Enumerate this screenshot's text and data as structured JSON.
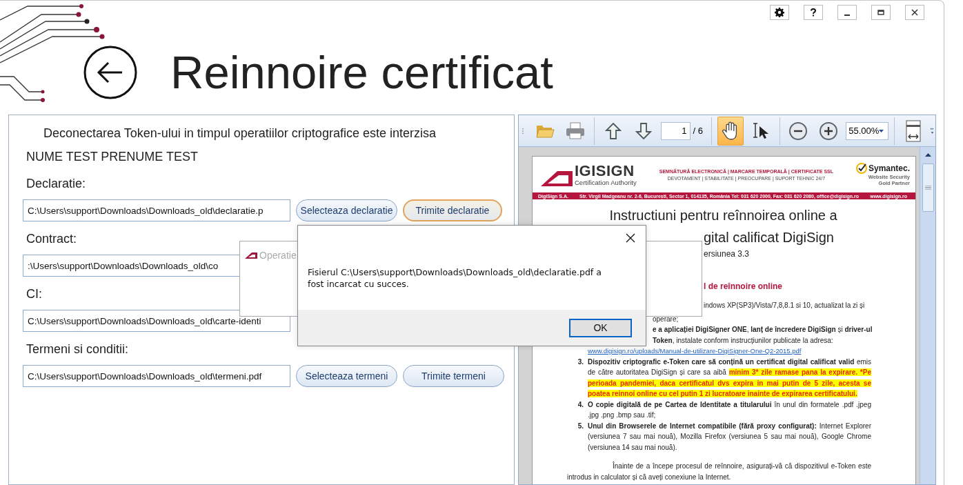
{
  "window": {
    "title": "Reinnoire certificat",
    "controls": [
      {
        "kind": "settings"
      },
      {
        "kind": "help"
      },
      {
        "kind": "minimize"
      },
      {
        "kind": "maximize"
      },
      {
        "kind": "close"
      }
    ]
  },
  "form": {
    "warning": "Deconectarea Token-ului in timpul operatiilor criptografice este interzisa",
    "holder": "NUME TEST PRENUME TEST",
    "rows": [
      {
        "label": "Declaratie:",
        "value": "C:\\Users\\support\\Downloads\\Downloads_old\\declaratie.p",
        "buttons": [
          {
            "label": "Selecteaza declaratie",
            "focused": false
          },
          {
            "label": "Trimite declaratie",
            "focused": true
          }
        ]
      },
      {
        "label": "Contract:",
        "value": ":\\Users\\support\\Downloads\\Downloads_old\\co"
      },
      {
        "label": "CI:",
        "value": "C:\\Users\\support\\Downloads\\Downloads_old\\carte-identi"
      },
      {
        "label": "Termeni si conditii:",
        "value": "C:\\Users\\support\\Downloads\\Downloads_old\\termeni.pdf",
        "buttons": [
          {
            "label": "Selecteaza termeni",
            "focused": false
          },
          {
            "label": "Trimite termeni",
            "focused": false
          }
        ]
      }
    ]
  },
  "viewer": {
    "toolbar": [
      {
        "kind": "open",
        "selected": false
      },
      {
        "kind": "print",
        "selected": false
      },
      {
        "kind": "sep"
      },
      {
        "kind": "prev",
        "selected": false
      },
      {
        "kind": "next",
        "selected": false
      },
      {
        "kind": "page",
        "value": "1",
        "total": "/ 6"
      },
      {
        "kind": "sep"
      },
      {
        "kind": "hand",
        "selected": true
      },
      {
        "kind": "select",
        "selected": false
      },
      {
        "kind": "sep"
      },
      {
        "kind": "zoom-out",
        "selected": false
      },
      {
        "kind": "zoom-in",
        "selected": false
      },
      {
        "kind": "zoom",
        "value": "55.00%"
      },
      {
        "kind": "sep"
      },
      {
        "kind": "fit-width",
        "selected": false
      }
    ],
    "document": {
      "logo_text": "IGISIGN",
      "logo_sub": "Certification Authority",
      "tagline": "SEMNĂTURĂ ELECTRONICĂ | MARCARE TEMPORALĂ | CERTIFICATE SSL",
      "values": "DEVOTAMENT | STABILITATE | PREOCUPARE | SUPORT TEHNIC 24/7",
      "partner": "Symantec.",
      "partner_sub": [
        "Website Security",
        "Gold Partner"
      ],
      "band": [
        "DigiSign S.A.",
        "Str. Virgil Madgeanu nr. 2-6, București, Sector 1, 014135, România Tel: 031 620 2000, Fax: 031 620 2080, office@digisign.ro",
        "www.digisign.ro"
      ],
      "lines": [
        {
          "kind": "title",
          "text": "Instructiuni pentru reînnoirea online a"
        },
        {
          "kind": "title-part",
          "text": "gital calificat DigiSign"
        },
        {
          "kind": "version-part",
          "text": "ersiunea 3.3"
        },
        {
          "kind": "heading-part",
          "text": "l de reînnoire online"
        },
        {
          "kind": "body-part",
          "text": "indows XP(SP3)/Vista/7,8,8.1 si 10, actualizat la zi și"
        },
        {
          "kind": "body-part-low",
          "text": "operare;"
        },
        {
          "kind": "body-part-low",
          "text": "**e a aplicației DigiSigner ONE**, **lanț de încredere DigiSign** și **driver-ul**"
        },
        {
          "kind": "body-part-low",
          "text": "**Token**, instalate conform instrucțiunilor publicate la adresa:"
        },
        {
          "kind": "link",
          "text": "www.digisign.ro/uploads/Manual-de-utilizare-DigiSigner-One-Q2-2015.pdf"
        },
        {
          "kind": "item",
          "number": "3.",
          "text": "**Dispozitiv criptografic e-Token care să conțină un certificat digital calificat valid** emis de către autoritatea DigiSign și care sa aibă ",
          "highlight": "minim 3* zile ramase pana la expirare. *Pe perioada pandemiei, daca certificatul dvs expira in mai putin de 5 zile, acesta se poatea reinnoi online cu cel putin 1 zi lucratoare inainte de expirarea certificatului."
        },
        {
          "kind": "item",
          "number": "4.",
          "text": "**O copie digitală de pe Cartea de Identitate a titularului** în unul din formatele .pdf .jpeg .jpg .png .bmp sau .tif;"
        },
        {
          "kind": "item",
          "number": "5.",
          "text": "**Unul din Browserele de Internet compatibile (fără proxy configurat):** Internet Explorer (versiunea 7 sau mai nouă), Mozilla Firefox (versiunea 5 sau mai nouă), Google Chrome (versiunea 14 sau mai nouă)."
        },
        {
          "kind": "paragraph",
          "text": "Înainte de a începe procesul de reînnoire, asigurați-vă că dispozitivul e-Token este introdus in calculator și că aveți conexiune la Internet."
        }
      ]
    }
  },
  "background_window": {
    "title": "Operatie"
  },
  "dialog": {
    "message": "Fisierul C:\\Users\\support\\Downloads\\Downloads_old\\declaratie.pdf a fost incarcat cu succes.",
    "button": "OK"
  }
}
